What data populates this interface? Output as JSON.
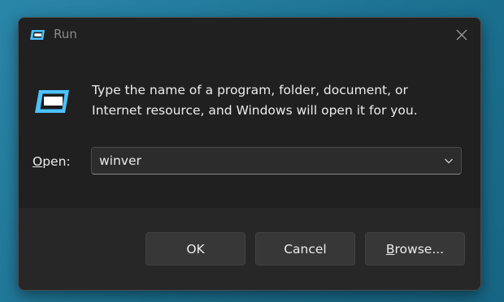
{
  "window": {
    "title": "Run"
  },
  "dialog": {
    "message": "Type the name of a program, folder, document, or Internet resource, and Windows will open it for you.",
    "open_label_accel": "O",
    "open_label_rest": "pen:",
    "open_value": "winver"
  },
  "buttons": {
    "ok_label": "OK",
    "cancel_label": "Cancel",
    "browse_accel": "B",
    "browse_rest": "rowse..."
  },
  "icons": {
    "run_app": "run-app-icon",
    "close": "close-icon",
    "dropdown": "chevron-down-icon"
  },
  "colors": {
    "accent_icon": "#4cc2ff",
    "dialog_bg": "#202020",
    "footer_bg": "#272727",
    "text": "#ececec"
  }
}
